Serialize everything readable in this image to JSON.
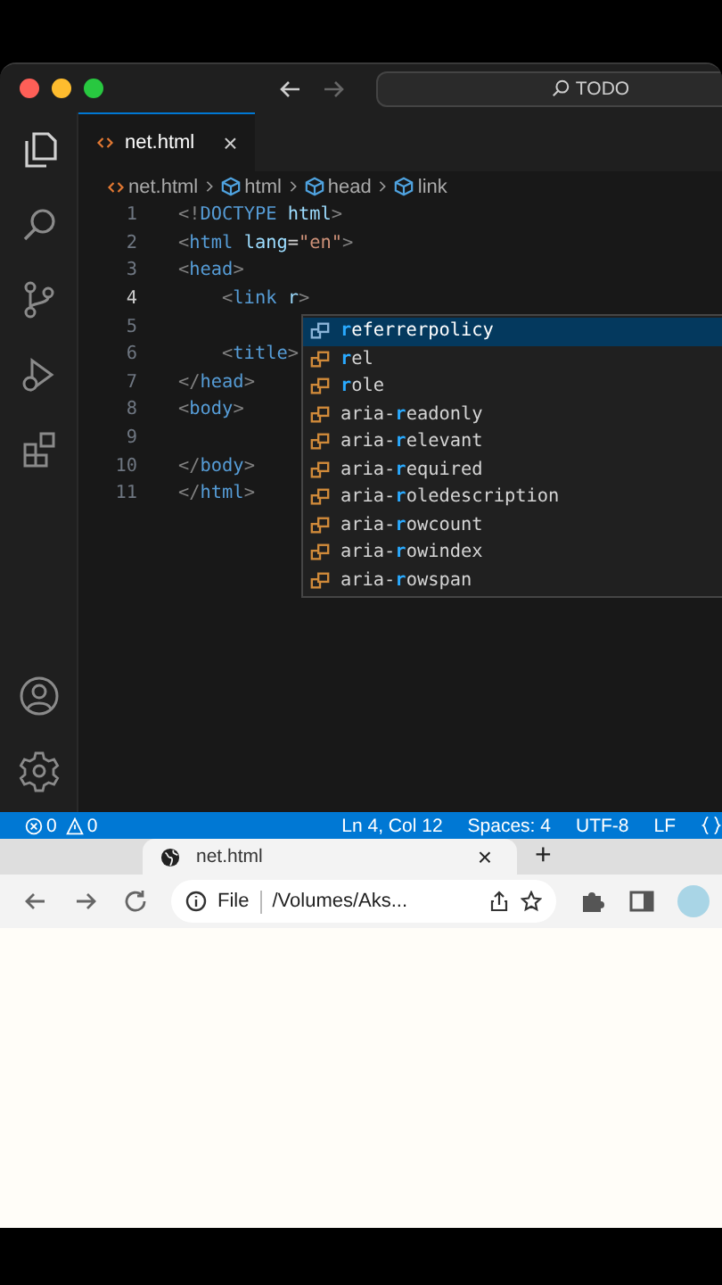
{
  "title_bar": {
    "search": "TODO"
  },
  "activity_bar": {
    "items": [
      {
        "selected": true
      },
      {
        "selected": false
      },
      {
        "selected": false
      },
      {
        "selected": false
      },
      {
        "selected": false
      }
    ]
  },
  "tabs": [
    {
      "label": "net.html",
      "close": "×",
      "selected": true
    }
  ],
  "breadcrumbs": [
    "net.html",
    "html",
    "head",
    "link"
  ],
  "code": {
    "lines": [
      {
        "number": "1",
        "active": false,
        "tokens": [
          {
            "t": "<!",
            "kind": "punct"
          },
          {
            "t": "DOCTYPE",
            "kind": "tag"
          },
          {
            "t": " html",
            "kind": "attr"
          },
          {
            "t": ">",
            "kind": "punct"
          }
        ]
      },
      {
        "number": "2",
        "active": false,
        "tokens": [
          {
            "t": "<",
            "kind": "punct"
          },
          {
            "t": "html",
            "kind": "tag"
          },
          {
            "t": " lang",
            "kind": "attr"
          },
          {
            "t": "=",
            "kind": "text"
          },
          {
            "t": "\"en\"",
            "kind": "string"
          },
          {
            "t": ">",
            "kind": "punct"
          }
        ]
      },
      {
        "number": "3",
        "active": false,
        "tokens": [
          {
            "t": "<",
            "kind": "punct"
          },
          {
            "t": "head",
            "kind": "tag"
          },
          {
            "t": ">",
            "kind": "punct"
          }
        ]
      },
      {
        "number": "4",
        "active": true,
        "tokens": [
          {
            "t": "    <",
            "kind": "punct"
          },
          {
            "t": "link",
            "kind": "tag"
          },
          {
            "t": " r",
            "kind": "attr"
          },
          {
            "t": ">",
            "kind": "punct"
          }
        ]
      },
      {
        "number": "5",
        "active": false
      },
      {
        "number": "6",
        "active": false,
        "tokens": [
          {
            "t": "    <",
            "kind": "punct"
          },
          {
            "t": "title",
            "kind": "tag"
          },
          {
            "t": ">",
            "kind": "punct"
          }
        ]
      },
      {
        "number": "7",
        "active": false,
        "tokens": [
          {
            "t": "</",
            "kind": "punct"
          },
          {
            "t": "head",
            "kind": "tag"
          },
          {
            "t": ">",
            "kind": "punct"
          }
        ]
      },
      {
        "number": "8",
        "active": false,
        "tokens": [
          {
            "t": "<",
            "kind": "punct"
          },
          {
            "t": "body",
            "kind": "tag"
          },
          {
            "t": ">",
            "kind": "punct"
          }
        ]
      },
      {
        "number": "9",
        "active": false
      },
      {
        "number": "10",
        "active": false,
        "tokens": [
          {
            "t": "</",
            "kind": "punct"
          },
          {
            "t": "body",
            "kind": "tag"
          },
          {
            "t": ">",
            "kind": "punct"
          }
        ]
      },
      {
        "number": "11",
        "active": false,
        "tokens": [
          {
            "t": "</",
            "kind": "punct"
          },
          {
            "t": "html",
            "kind": "tag"
          },
          {
            "t": ">",
            "kind": "punct"
          }
        ]
      }
    ]
  },
  "suggestions": [
    {
      "match": "r",
      "after": "eferrerpolicy",
      "selected": true
    },
    {
      "match": "r",
      "after": "el",
      "selected": false
    },
    {
      "match": "r",
      "after": "ole",
      "selected": false
    },
    {
      "before": "aria-",
      "match": "r",
      "after": "eadonly",
      "selected": false
    },
    {
      "before": "aria-",
      "match": "r",
      "after": "elevant",
      "selected": false
    },
    {
      "before": "aria-",
      "match": "r",
      "after": "equired",
      "selected": false
    },
    {
      "before": "aria-",
      "match": "r",
      "after": "oledescription",
      "selected": false
    },
    {
      "before": "aria-",
      "match": "r",
      "after": "owcount",
      "selected": false
    },
    {
      "before": "aria-",
      "match": "r",
      "after": "owindex",
      "selected": false
    },
    {
      "before": "aria-",
      "match": "r",
      "after": "owspan",
      "selected": false
    }
  ],
  "status_bar": {
    "errors": "0",
    "warnings": "0",
    "items": [
      "Ln 4, Col 12",
      "Spaces: 4",
      "UTF-8",
      "LF"
    ]
  },
  "browser": {
    "tab": {
      "title": "net.html",
      "close": "×"
    },
    "new_tab": "+",
    "address": {
      "scheme": "File",
      "path": "/Volumes/Aks..."
    }
  }
}
